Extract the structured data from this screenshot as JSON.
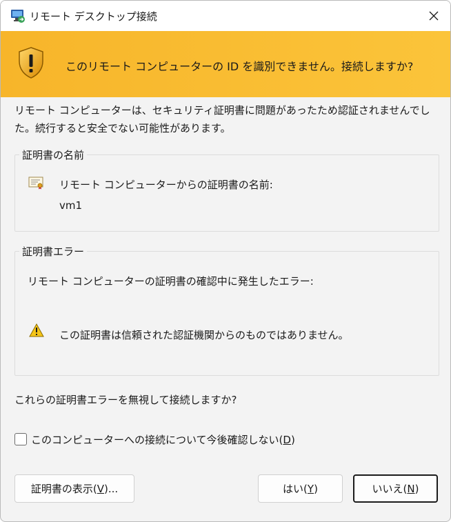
{
  "window": {
    "title": "リモート デスクトップ接続",
    "app_icon": "remote-desktop-icon",
    "close_icon": "close-icon"
  },
  "banner": {
    "icon": "security-shield-warning-icon",
    "message": "このリモート コンピューターの ID を識別できません。接続しますか?",
    "color": "#f9bb30"
  },
  "intro": {
    "text": "リモート コンピューターは、セキュリティ証明書に問題があったため認証されませんでした。続行すると安全でない可能性があります。"
  },
  "certificate_name_group": {
    "legend": "証明書の名前",
    "icon": "certificate-icon",
    "label": "リモート コンピューターからの証明書の名前:",
    "value": "vm1"
  },
  "certificate_error_group": {
    "legend": "証明書エラー",
    "label": "リモート コンピューターの証明書の確認中に発生したエラー:",
    "icon": "warning-icon",
    "error": "この証明書は信頼された認証機関からのものではありません。"
  },
  "question": "これらの証明書エラーを無視して接続しますか?",
  "checkbox": {
    "label_prefix": "このコンピューターへの接続について今後確認しない(",
    "label_key": "D",
    "label_suffix": ")",
    "checked": false
  },
  "buttons": {
    "view_cert": {
      "prefix": "証明書の表示(",
      "key": "V",
      "suffix": ")..."
    },
    "yes": {
      "prefix": "はい(",
      "key": "Y",
      "suffix": ")"
    },
    "no": {
      "prefix": "いいえ(",
      "key": "N",
      "suffix": ")"
    }
  }
}
